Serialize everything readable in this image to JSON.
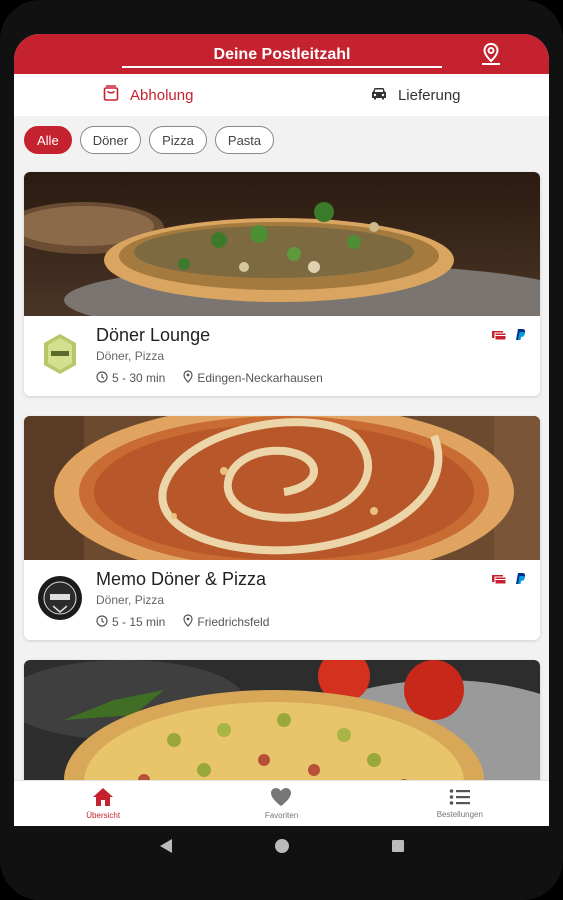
{
  "header": {
    "title": "Deine Postleitzahl",
    "location_icon": "map-pin-icon"
  },
  "tabs": [
    {
      "label": "Abholung",
      "icon": "shopping-bag-icon",
      "active": true
    },
    {
      "label": "Lieferung",
      "icon": "car-icon",
      "active": false
    }
  ],
  "filters": [
    {
      "label": "Alle",
      "active": true
    },
    {
      "label": "Döner",
      "active": false
    },
    {
      "label": "Pizza",
      "active": false
    },
    {
      "label": "Pasta",
      "active": false
    }
  ],
  "restaurants": [
    {
      "name": "Döner Lounge",
      "categories": "Döner, Pizza",
      "time": "5 - 30 min",
      "location": "Edingen-Neckarhausen",
      "payment_icons": [
        "card-icon",
        "paypal-icon"
      ]
    },
    {
      "name": "Memo Döner & Pizza",
      "categories": "Döner, Pizza",
      "time": "5 - 15 min",
      "location": "Friedrichsfeld",
      "payment_icons": [
        "card-icon",
        "paypal-icon"
      ]
    }
  ],
  "bottom_nav": [
    {
      "label": "Übersicht",
      "icon": "home-icon",
      "active": true
    },
    {
      "label": "Favoriten",
      "icon": "heart-icon",
      "active": false
    },
    {
      "label": "Bestellungen",
      "icon": "list-icon",
      "active": false
    }
  ],
  "colors": {
    "primary": "#c5222f",
    "background": "#f2f2f2"
  }
}
